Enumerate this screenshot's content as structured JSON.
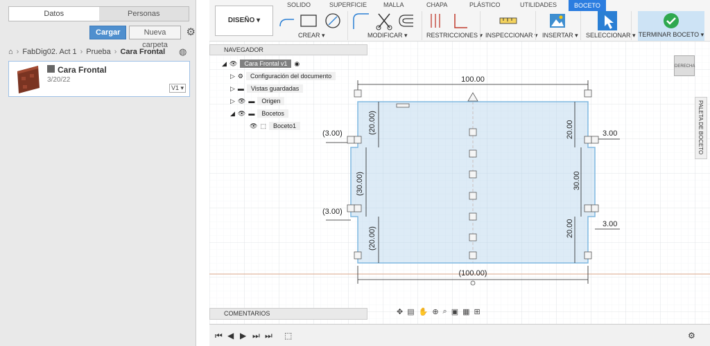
{
  "left": {
    "tabs": [
      "Datos",
      "Personas"
    ],
    "upload_label": "Cargar",
    "new_folder_label": "Nueva carpeta",
    "breadcrumb": [
      "FabDig02. Act 1",
      "Prueba",
      "Cara Frontal"
    ],
    "file": {
      "title": "Cara Frontal",
      "date": "3/20/22",
      "version": "V1 ▾"
    }
  },
  "toolbar": {
    "workspace": "DISEÑO ▾",
    "tabs": [
      "SOLIDO",
      "SUPERFICIE",
      "MALLA",
      "CHAPA",
      "PLÁSTICO",
      "UTILIDADES",
      "BOCETO"
    ],
    "groups": [
      "CREAR ▾",
      "MODIFICAR ▾",
      "RESTRICCIONES ▾",
      "INSPECCIONAR ▾",
      "INSERTAR ▾",
      "SELECCIONAR ▾"
    ],
    "finish_label": "TERMINAR BOCETO ▾"
  },
  "navigator": {
    "title": "NAVEGADOR",
    "root": "Cara Frontal v1",
    "items": [
      "Configuración del documento",
      "Vistas guardadas",
      "Origen",
      "Bocetos",
      "Boceto1"
    ]
  },
  "comments": "COMENTARIOS",
  "palette": "PALETA DE BOCETO",
  "viewcube": "DERECHA",
  "sketch": {
    "dims": {
      "top": "100.00",
      "bottom": "(100.00)",
      "left_top": "(20.00)",
      "left_mid": "(30.00)",
      "left_bot": "(20.00)",
      "right_top": "20.00",
      "right_mid": "30.00",
      "right_bot": "20.00",
      "left_off_top": "(3.00)",
      "left_off_bot": "(3.00)",
      "right_off_top": "3.00",
      "right_off_bot": "3.00"
    }
  }
}
